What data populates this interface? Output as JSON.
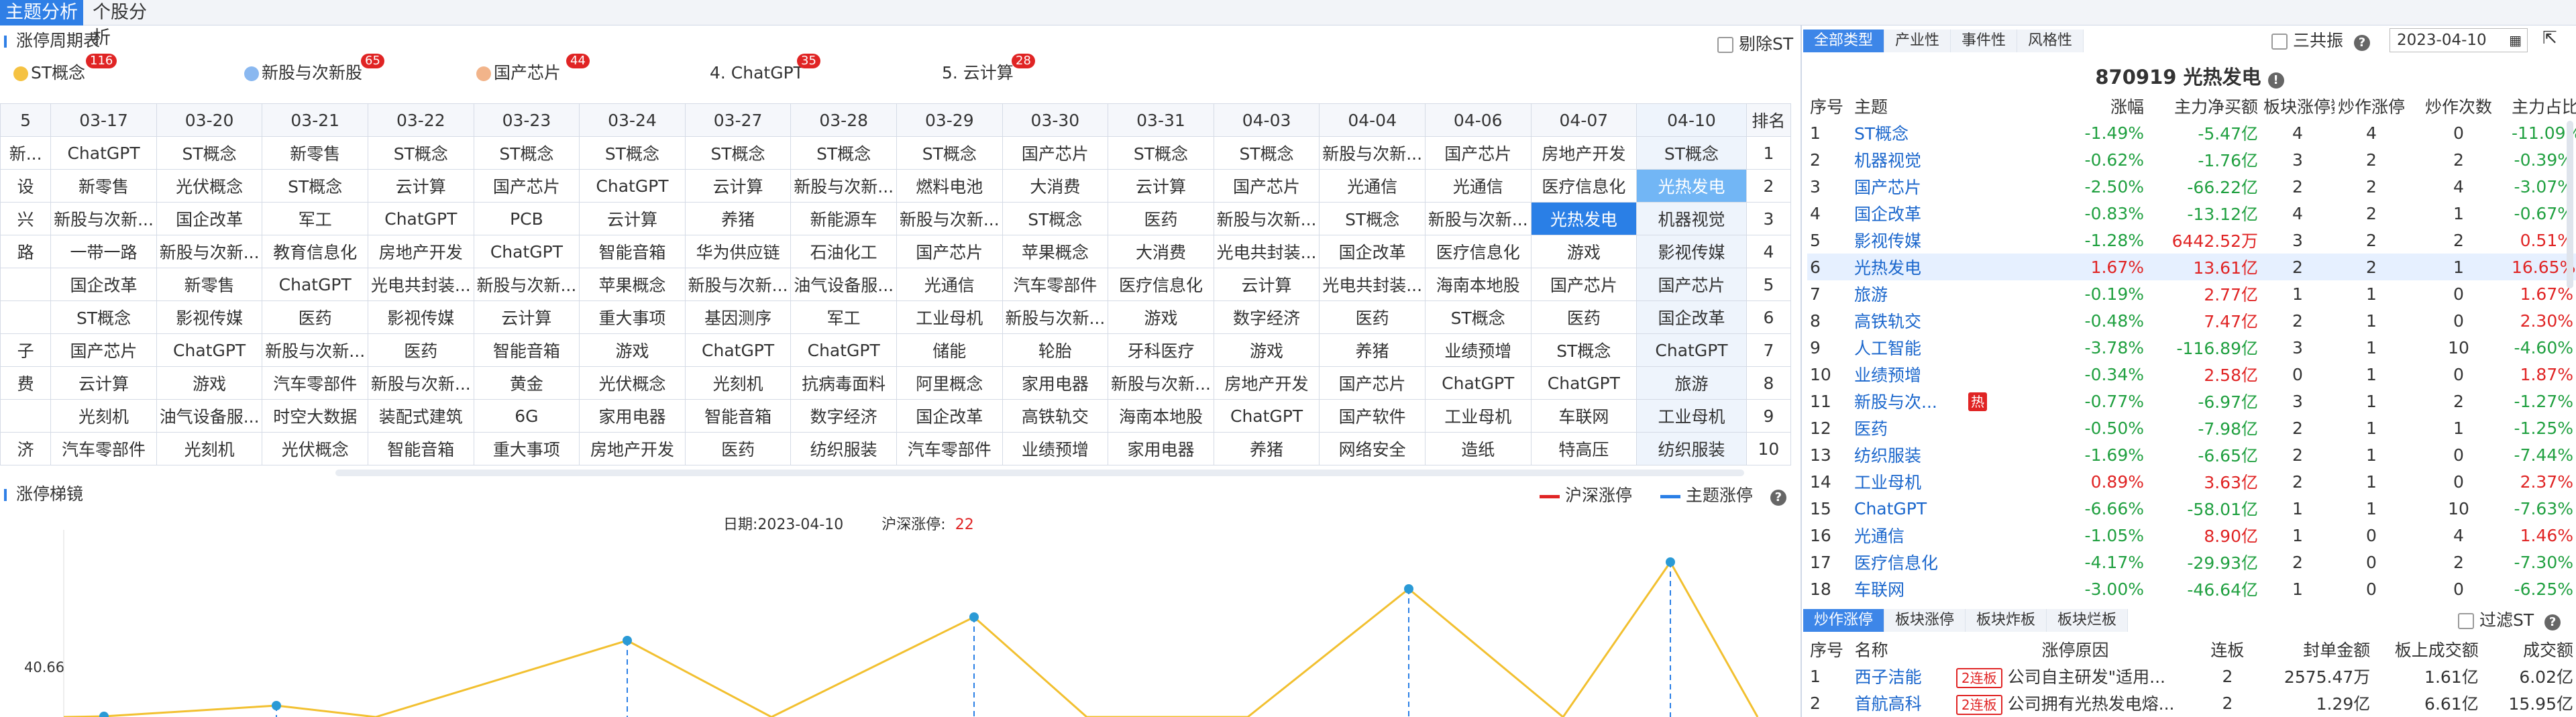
{
  "topnav": {
    "tabs": [
      "主题分析",
      "个股分析"
    ]
  },
  "cycle": {
    "title": "涨停周期表",
    "exclude_st": "剔除ST",
    "themes": [
      {
        "label": "ST概念",
        "count": "116",
        "color": "#f5c242"
      },
      {
        "label": "新股与次新股",
        "count": "65",
        "color": "#8ab8f0"
      },
      {
        "label": "国产芯片",
        "count": "44",
        "color": "#f2b48a"
      },
      {
        "label": "4. ChatGPT",
        "count": "35",
        "color": ""
      },
      {
        "label": "5. 云计算",
        "count": "28",
        "color": ""
      }
    ],
    "rank_header": "排名",
    "ranks": [
      "1",
      "2",
      "3",
      "4",
      "5",
      "6",
      "7",
      "8",
      "9",
      "10"
    ],
    "dates": [
      "5",
      "03-17",
      "03-20",
      "03-21",
      "03-22",
      "03-23",
      "03-24",
      "03-27",
      "03-28",
      "03-29",
      "03-30",
      "03-31",
      "04-03",
      "04-04",
      "04-06",
      "04-07",
      "04-10"
    ],
    "rows": [
      [
        "新...",
        "ChatGPT",
        "ST概念",
        "新零售",
        "ST概念",
        "ST概念",
        "ST概念",
        "ST概念",
        "ST概念",
        "ST概念",
        "国产芯片",
        "ST概念",
        "ST概念",
        "新股与次新...",
        "国产芯片",
        "房地产开发",
        "ST概念"
      ],
      [
        "设",
        "新零售",
        "光伏概念",
        "ST概念",
        "云计算",
        "国产芯片",
        "ChatGPT",
        "云计算",
        "新股与次新...",
        "燃料电池",
        "大消费",
        "云计算",
        "国产芯片",
        "光通信",
        "光通信",
        "医疗信息化",
        "光热发电"
      ],
      [
        "兴",
        "新股与次新...",
        "国企改革",
        "军工",
        "ChatGPT",
        "PCB",
        "云计算",
        "养猪",
        "新能源车",
        "新股与次新...",
        "ST概念",
        "医药",
        "新股与次新...",
        "ST概念",
        "新股与次新...",
        "光热发电",
        "机器视觉"
      ],
      [
        "路",
        "一带一路",
        "新股与次新...",
        "教育信息化",
        "房地产开发",
        "ChatGPT",
        "智能音箱",
        "华为供应链",
        "石油化工",
        "国产芯片",
        "苹果概念",
        "大消费",
        "光电共封装...",
        "国企改革",
        "医疗信息化",
        "游戏",
        "影视传媒"
      ],
      [
        "",
        "国企改革",
        "新零售",
        "ChatGPT",
        "光电共封装...",
        "新股与次新...",
        "苹果概念",
        "新股与次新...",
        "油气设备服...",
        "光通信",
        "汽车零部件",
        "医疗信息化",
        "云计算",
        "光电共封装...",
        "海南本地股",
        "国产芯片",
        "国产芯片"
      ],
      [
        "",
        "ST概念",
        "影视传媒",
        "医药",
        "影视传媒",
        "云计算",
        "重大事项",
        "基因测序",
        "军工",
        "工业母机",
        "新股与次新...",
        "游戏",
        "数字经济",
        "医药",
        "ST概念",
        "医药",
        "国企改革"
      ],
      [
        "子",
        "国产芯片",
        "ChatGPT",
        "新股与次新...",
        "医药",
        "智能音箱",
        "游戏",
        "ChatGPT",
        "ChatGPT",
        "储能",
        "轮胎",
        "牙科医疗",
        "游戏",
        "养猪",
        "业绩预增",
        "ST概念",
        "ChatGPT"
      ],
      [
        "费",
        "云计算",
        "游戏",
        "汽车零部件",
        "新股与次新...",
        "黄金",
        "光伏概念",
        "光刻机",
        "抗病毒面料",
        "阿里概念",
        "家用电器",
        "新股与次新...",
        "房地产开发",
        "国产芯片",
        "ChatGPT",
        "ChatGPT",
        "旅游"
      ],
      [
        "",
        "光刻机",
        "油气设备服...",
        "时空大数据",
        "装配式建筑",
        "6G",
        "家用电器",
        "智能音箱",
        "数字经济",
        "国企改革",
        "高铁轨交",
        "海南本地股",
        "ChatGPT",
        "国产软件",
        "工业母机",
        "车联网",
        "工业母机"
      ],
      [
        "济",
        "汽车零部件",
        "光刻机",
        "光伏概念",
        "智能音箱",
        "重大事项",
        "房地产开发",
        "医药",
        "纺织服装",
        "汽车零部件",
        "业绩预增",
        "家用电器",
        "养猪",
        "网络安全",
        "造纸",
        "特高压",
        "纺织服装"
      ]
    ]
  },
  "ladder": {
    "title": "涨停梯镜",
    "legend_hs": "沪深涨停",
    "legend_theme": "主题涨停",
    "date_label": "日期:",
    "date_value": "2023-04-10",
    "hs_label": "沪深涨停:",
    "hs_value": "22",
    "ytick": "40.66"
  },
  "chart_data": {
    "type": "line",
    "series": [
      {
        "name": "沪深涨停",
        "color": "#e02424",
        "values": []
      },
      {
        "name": "主题涨停",
        "color": "#2a7fe6",
        "values": []
      }
    ],
    "ytick_visible": "40.66"
  },
  "right": {
    "tabs": [
      "全部类型",
      "产业性",
      "事件性",
      "风格性"
    ],
    "sangong": "三共振",
    "date": "2023-04-10",
    "stock_title": "870919 光热发电",
    "headers": [
      "序号",
      "主题",
      "涨幅",
      "主力净买额",
      "板块涨停数",
      "炒作涨停",
      "炒作次数",
      "主力占比"
    ],
    "rows": [
      {
        "no": "1",
        "name": "ST概念",
        "chg": "-1.49%",
        "net": "-5.47亿",
        "a": "4",
        "b": "4",
        "c": "0",
        "pct": "-11.09%",
        "hot": ""
      },
      {
        "no": "2",
        "name": "机器视觉",
        "chg": "-0.62%",
        "net": "-1.76亿",
        "a": "3",
        "b": "2",
        "c": "2",
        "pct": "-0.39%",
        "hot": ""
      },
      {
        "no": "3",
        "name": "国产芯片",
        "chg": "-2.50%",
        "net": "-66.22亿",
        "a": "2",
        "b": "2",
        "c": "4",
        "pct": "-3.07%",
        "hot": ""
      },
      {
        "no": "4",
        "name": "国企改革",
        "chg": "-0.83%",
        "net": "-13.12亿",
        "a": "4",
        "b": "2",
        "c": "1",
        "pct": "-0.67%",
        "hot": ""
      },
      {
        "no": "5",
        "name": "影视传媒",
        "chg": "-1.28%",
        "net": "6442.52万",
        "a": "3",
        "b": "2",
        "c": "2",
        "pct": "0.51%",
        "hot": ""
      },
      {
        "no": "6",
        "name": "光热发电",
        "chg": "1.67%",
        "net": "13.61亿",
        "a": "2",
        "b": "2",
        "c": "1",
        "pct": "16.65%",
        "hot": ""
      },
      {
        "no": "7",
        "name": "旅游",
        "chg": "-0.19%",
        "net": "2.77亿",
        "a": "1",
        "b": "1",
        "c": "0",
        "pct": "1.67%",
        "hot": ""
      },
      {
        "no": "8",
        "name": "高铁轨交",
        "chg": "-0.48%",
        "net": "7.47亿",
        "a": "2",
        "b": "1",
        "c": "0",
        "pct": "2.30%",
        "hot": ""
      },
      {
        "no": "9",
        "name": "人工智能",
        "chg": "-3.78%",
        "net": "-116.89亿",
        "a": "3",
        "b": "1",
        "c": "10",
        "pct": "-4.60%",
        "hot": ""
      },
      {
        "no": "10",
        "name": "业绩预增",
        "chg": "-0.34%",
        "net": "2.58亿",
        "a": "0",
        "b": "1",
        "c": "0",
        "pct": "1.87%",
        "hot": ""
      },
      {
        "no": "11",
        "name": "新股与次...",
        "chg": "-0.77%",
        "net": "-6.97亿",
        "a": "3",
        "b": "1",
        "c": "2",
        "pct": "-1.27%",
        "hot": "热"
      },
      {
        "no": "12",
        "name": "医药",
        "chg": "-0.50%",
        "net": "-7.98亿",
        "a": "2",
        "b": "1",
        "c": "1",
        "pct": "-1.25%",
        "hot": ""
      },
      {
        "no": "13",
        "name": "纺织服装",
        "chg": "-1.69%",
        "net": "-6.65亿",
        "a": "2",
        "b": "1",
        "c": "0",
        "pct": "-7.44%",
        "hot": ""
      },
      {
        "no": "14",
        "name": "工业母机",
        "chg": "0.89%",
        "net": "3.63亿",
        "a": "2",
        "b": "1",
        "c": "0",
        "pct": "2.37%",
        "hot": ""
      },
      {
        "no": "15",
        "name": "ChatGPT",
        "chg": "-6.66%",
        "net": "-58.01亿",
        "a": "1",
        "b": "1",
        "c": "10",
        "pct": "-7.63%",
        "hot": ""
      },
      {
        "no": "16",
        "name": "光通信",
        "chg": "-1.05%",
        "net": "8.90亿",
        "a": "1",
        "b": "0",
        "c": "4",
        "pct": "1.46%",
        "hot": ""
      },
      {
        "no": "17",
        "name": "医疗信息化",
        "chg": "-4.17%",
        "net": "-29.93亿",
        "a": "2",
        "b": "0",
        "c": "2",
        "pct": "-7.30%",
        "hot": ""
      },
      {
        "no": "18",
        "name": "车联网",
        "chg": "-3.00%",
        "net": "-46.64亿",
        "a": "1",
        "b": "0",
        "c": "0",
        "pct": "-6.25%",
        "hot": ""
      }
    ],
    "btabs": [
      "炒作涨停",
      "板块涨停",
      "板块炸板",
      "板块烂板"
    ],
    "filter_st": "过滤ST",
    "bheaders": [
      "序号",
      "名称",
      "涨停原因",
      "连板",
      "封单金额",
      "板上成交额",
      "成交额"
    ],
    "brows": [
      {
        "no": "1",
        "name": "西子洁能",
        "tag": "2连板",
        "reason": "公司自主研发\"适用...",
        "lb": "2",
        "seal": "2575.47万",
        "onb": "1.61亿",
        "vol": "6.02亿"
      },
      {
        "no": "2",
        "name": "首航高科",
        "tag": "2连板",
        "reason": "公司拥有光热发电熔...",
        "lb": "2",
        "seal": "1.29亿",
        "onb": "6.61亿",
        "vol": "15.95亿"
      }
    ]
  }
}
